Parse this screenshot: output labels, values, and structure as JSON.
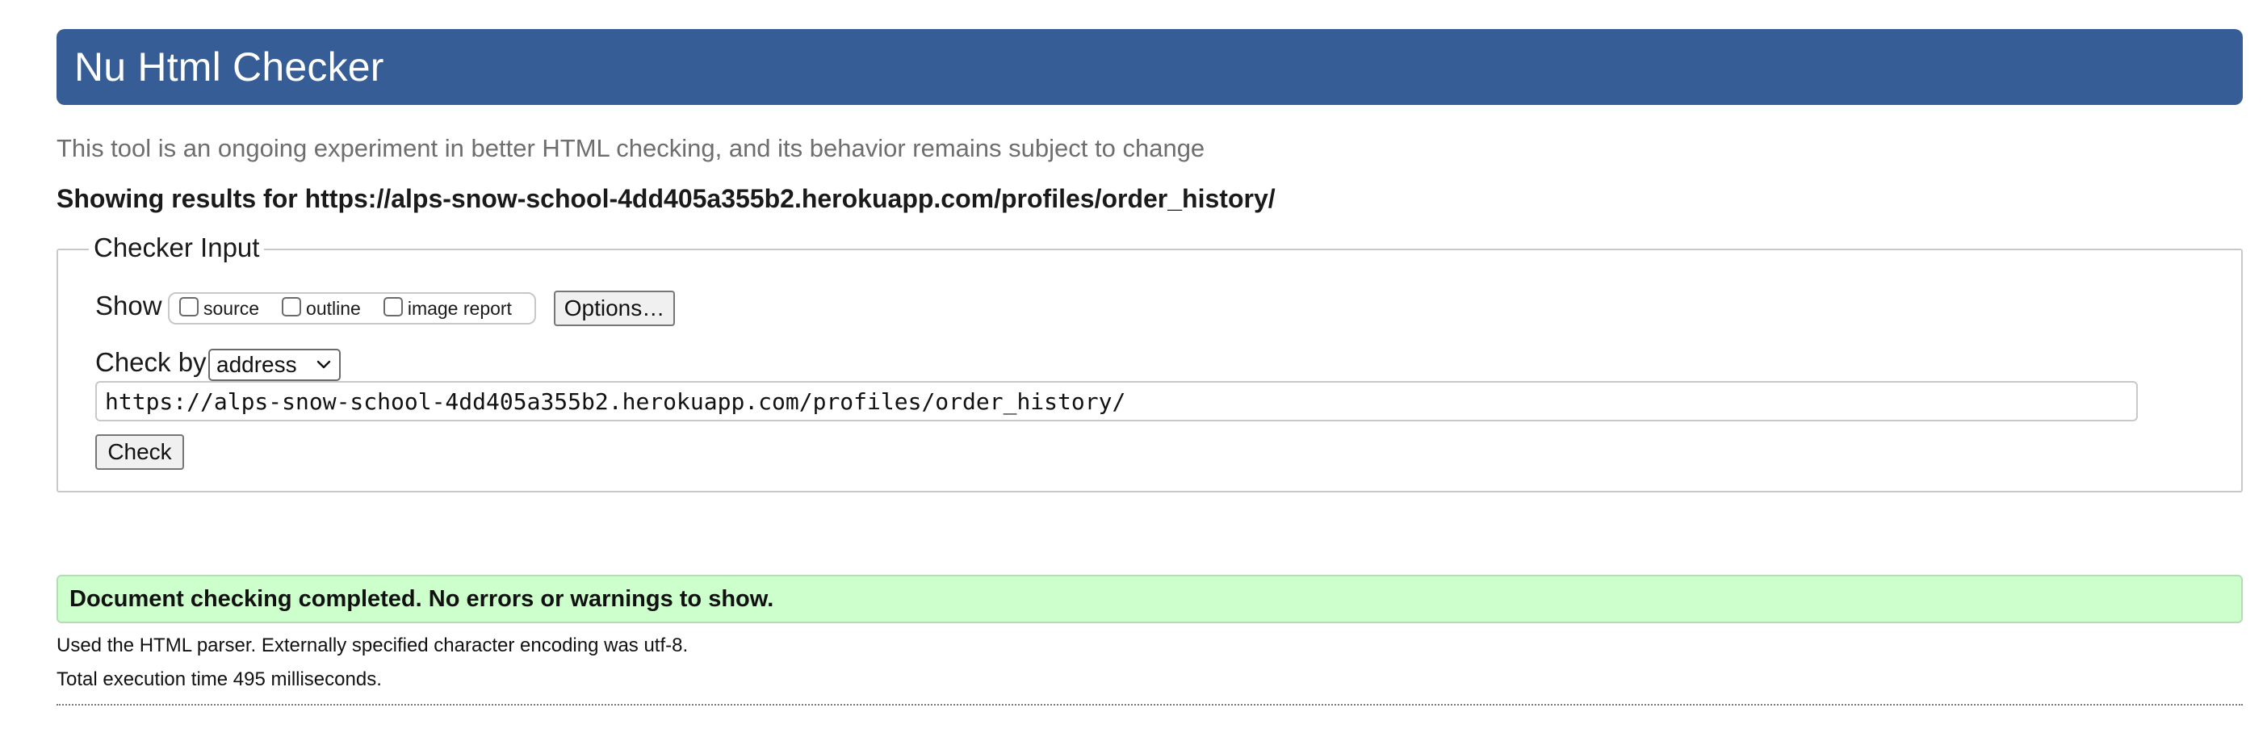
{
  "header": {
    "title": "Nu Html Checker"
  },
  "subtitle": "This tool is an ongoing experiment in better HTML checking, and its behavior remains subject to change",
  "results_heading": "Showing results for https://alps-snow-school-4dd405a355b2.herokuapp.com/profiles/order_history/",
  "checker_input": {
    "legend": "Checker Input",
    "show_label": "Show",
    "options": [
      {
        "label": "source",
        "checked": false
      },
      {
        "label": "outline",
        "checked": false
      },
      {
        "label": "image report",
        "checked": false
      }
    ],
    "options_button": "Options…",
    "check_by_label": "Check by",
    "check_by_selected": "address",
    "url_value": "https://alps-snow-school-4dd405a355b2.herokuapp.com/profiles/order_history/",
    "check_button": "Check"
  },
  "result": {
    "success_message": "Document checking completed. No errors or warnings to show.",
    "parser_info": "Used the HTML parser. Externally specified character encoding was utf-8.",
    "execution_time": "Total execution time 495 milliseconds."
  },
  "colors": {
    "header_bg": "#365d95",
    "success_bg": "#ccffcc"
  },
  "icons": {
    "select_arrow": "chevron-down-icon"
  }
}
